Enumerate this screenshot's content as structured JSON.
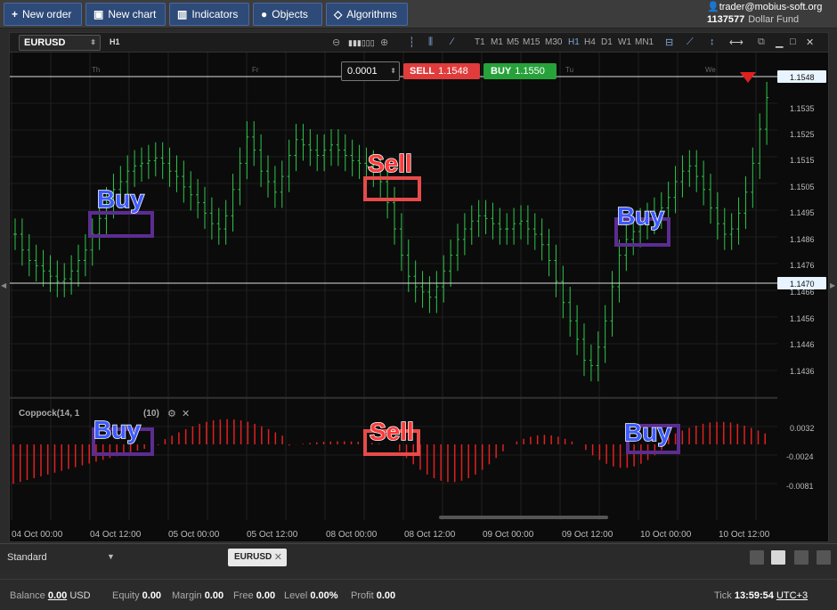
{
  "toolbar": {
    "new_order": "New order",
    "new_chart": "New chart",
    "indicators": "Indicators",
    "objects": "Objects",
    "algorithms": "Algorithms"
  },
  "account": {
    "user": "trader@mobius-soft.org",
    "number": "1137577",
    "fund": "Dollar Fund"
  },
  "chart": {
    "symbol": "EURUSD",
    "timeframe_label": "H1",
    "timeframes": [
      "T1",
      "M1",
      "M5",
      "M15",
      "M30",
      "H1",
      "H4",
      "D1",
      "W1",
      "MN1"
    ],
    "active_timeframe": "H1",
    "lot": "0.0001",
    "sell_label": "SELL",
    "sell_price": "1.1548",
    "buy_label": "BUY",
    "buy_price": "1.1550",
    "day_labels": [
      "Th",
      "Fr",
      "Tu",
      "We"
    ],
    "price_ticks": [
      "1.1535",
      "1.1525",
      "1.1515",
      "1.1505",
      "1.1495",
      "1.1486",
      "1.1476",
      "1.1466",
      "1.1456",
      "1.1446",
      "1.1436"
    ],
    "current_price_tag": "1.1548",
    "line_price_tag": "1.1470",
    "indicator_title": "Coppock(14, 1",
    "indicator_title_tail": "(10)",
    "indicator_ticks": [
      "0.0032",
      "-0.0024",
      "-0.0081"
    ],
    "time_labels": [
      "04 Oct 00:00",
      "04 Oct 12:00",
      "05 Oct 00:00",
      "05 Oct 12:00",
      "08 Oct 00:00",
      "08 Oct 12:00",
      "09 Oct 00:00",
      "09 Oct 12:00",
      "10 Oct 00:00",
      "10 Oct 12:00"
    ],
    "annotations": {
      "buy1": "Buy",
      "sell1": "Sell",
      "buy2": "Buy",
      "buy3": "Buy",
      "sell2": "Sell",
      "buy4": "Buy"
    }
  },
  "tabbar": {
    "workspace": "Standard",
    "tab": "EURUSD"
  },
  "status": {
    "balance_label": "Balance",
    "balance_value": "0.00",
    "balance_currency": "USD",
    "equity_label": "Equity",
    "equity_value": "0.00",
    "margin_label": "Margin",
    "margin_value": "0.00",
    "free_label": "Free",
    "free_value": "0.00",
    "level_label": "Level",
    "level_value": "0.00%",
    "profit_label": "Profit",
    "profit_value": "0.00",
    "tick_label": "Tick",
    "time": "13:59:54",
    "timezone": "UTC+3"
  },
  "colors": {
    "bull": "#2ec74a",
    "bear_ind": "#e02020",
    "buy_box": "#5b2d91",
    "sell_box": "#e84a4a",
    "buy_text": "#3d5bff",
    "sell_text": "#ff3a3a"
  }
}
